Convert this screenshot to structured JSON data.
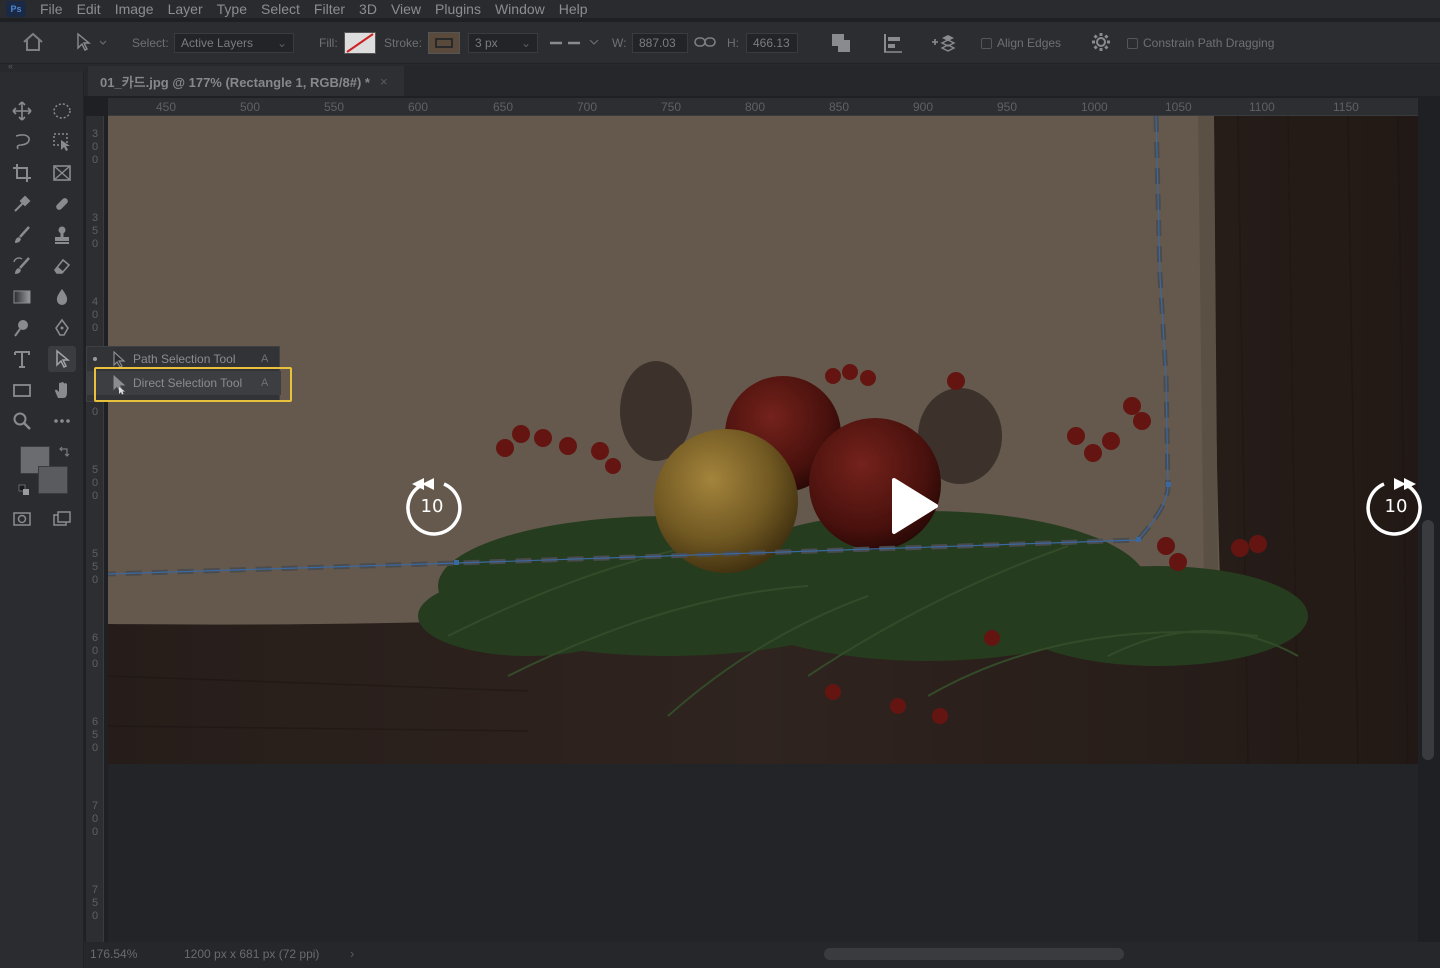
{
  "menubar": {
    "logo": "Ps",
    "items": [
      "File",
      "Edit",
      "Image",
      "Layer",
      "Type",
      "Select",
      "Filter",
      "3D",
      "View",
      "Plugins",
      "Window",
      "Help"
    ]
  },
  "options": {
    "select_label": "Select:",
    "select_value": "Active Layers",
    "fill_label": "Fill:",
    "stroke_label": "Stroke:",
    "stroke_width": "3 px",
    "w_label": "W:",
    "w_value": "887.03",
    "h_label": "H:",
    "h_value": "466.13",
    "align_edges": "Align Edges",
    "constrain": "Constrain Path Dragging"
  },
  "tab": {
    "title": "01_카드.jpg @ 177% (Rectangle 1, RGB/8#) *",
    "close": "×"
  },
  "ruler": {
    "h_labels": [
      "450",
      "500",
      "550",
      "600",
      "650",
      "700",
      "750",
      "800",
      "850",
      "900",
      "950",
      "1000",
      "1050",
      "1100",
      "1150"
    ],
    "v_labels": [
      "300",
      "350",
      "400",
      "450",
      "500",
      "550",
      "600",
      "650",
      "700",
      "750"
    ]
  },
  "flyout": {
    "items": [
      {
        "label": "Path Selection Tool",
        "key": "A"
      },
      {
        "label": "Direct Selection Tool",
        "key": "A"
      }
    ]
  },
  "video": {
    "rewind_seconds": "10",
    "forward_seconds": "10"
  },
  "status": {
    "zoom": "176.54%",
    "doc_size": "1200 px x 681 px (72 ppi)",
    "arrow": "›"
  },
  "colors": {
    "highlight": "#e8c23a",
    "path": "#4a7fc4"
  }
}
